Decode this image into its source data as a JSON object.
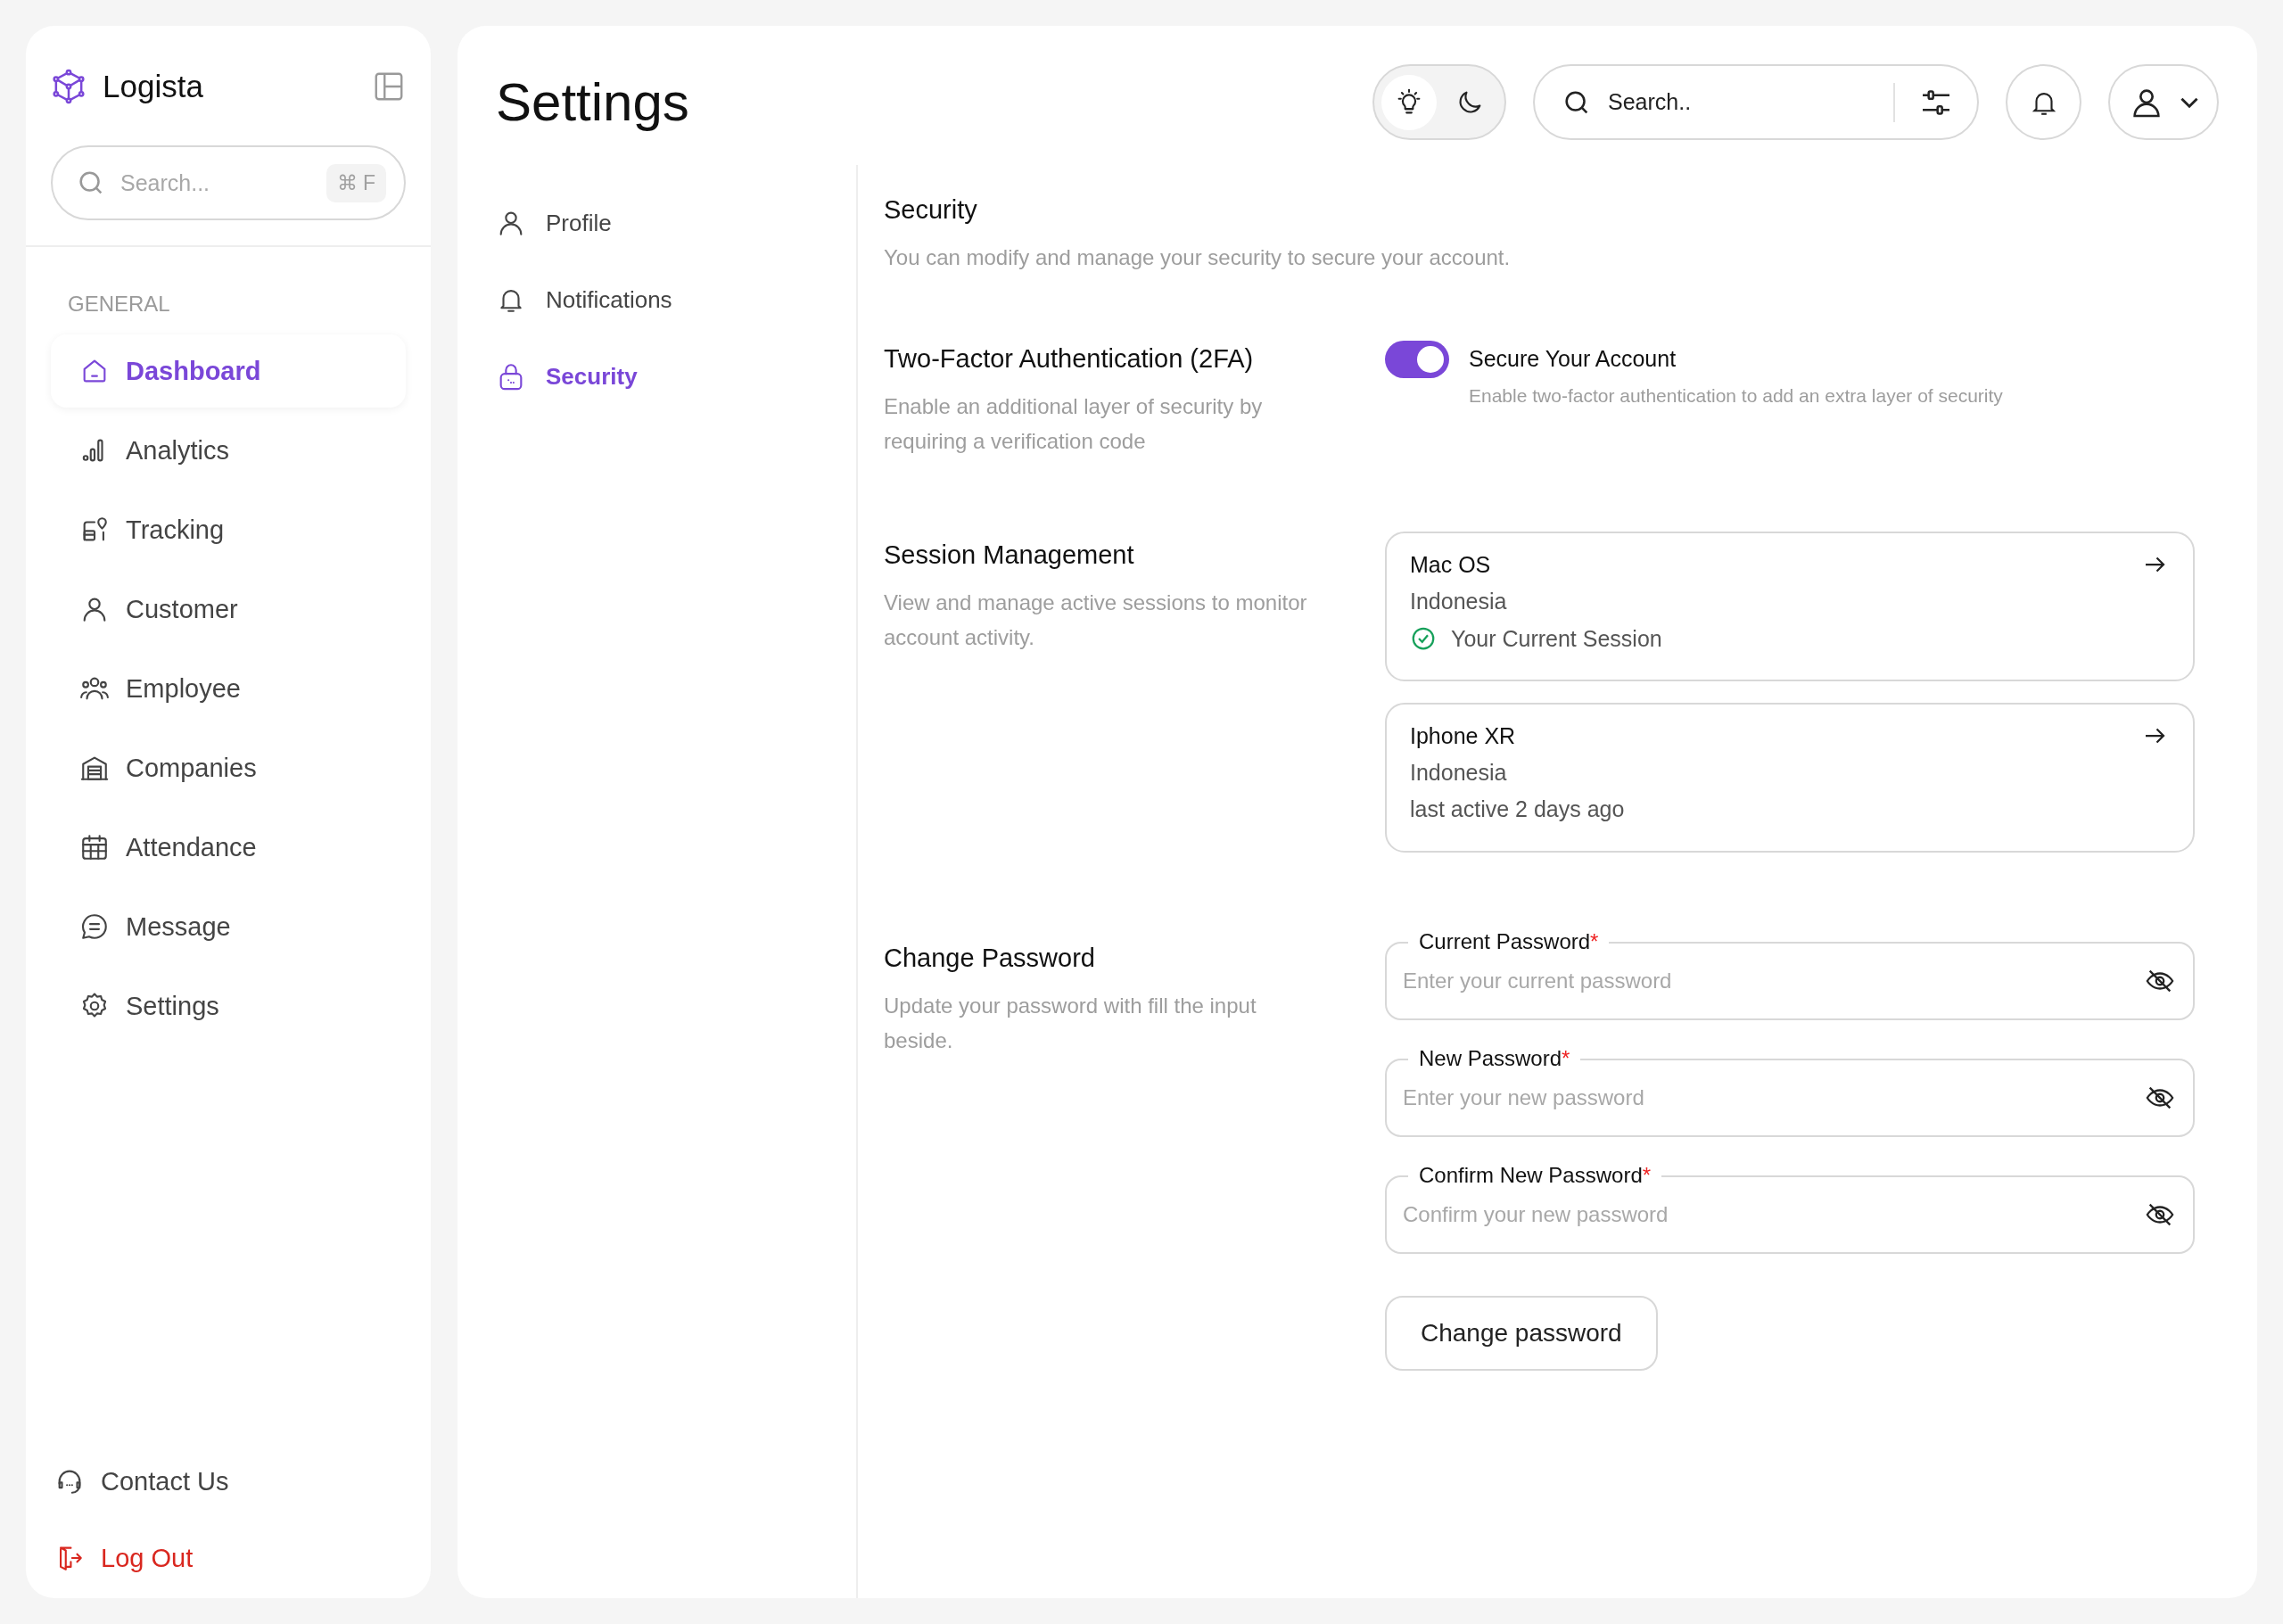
{
  "sidebar": {
    "brand": "Logista",
    "search": {
      "placeholder": "Search...",
      "shortcut": "⌘ F"
    },
    "section_label": "GENERAL",
    "items": [
      {
        "label": "Dashboard",
        "selected": true
      },
      {
        "label": "Analytics",
        "selected": false
      },
      {
        "label": "Tracking",
        "selected": false
      },
      {
        "label": "Customer",
        "selected": false
      },
      {
        "label": "Employee",
        "selected": false
      },
      {
        "label": "Companies",
        "selected": false
      },
      {
        "label": "Attendance",
        "selected": false
      },
      {
        "label": "Message",
        "selected": false
      },
      {
        "label": "Settings",
        "selected": false
      }
    ],
    "footer_items": [
      {
        "label": "Contact Us",
        "kind": "normal"
      },
      {
        "label": "Log Out",
        "kind": "danger"
      }
    ]
  },
  "header": {
    "title": "Settings",
    "theme_toggle": [
      {
        "kind": "light",
        "selected": true
      },
      {
        "kind": "dark",
        "selected": false
      }
    ],
    "search": {
      "placeholder": "Search.."
    }
  },
  "settings_nav": [
    {
      "label": "Profile",
      "selected": false
    },
    {
      "label": "Notifications",
      "selected": false
    },
    {
      "label": "Security",
      "selected": true
    }
  ],
  "security": {
    "title": "Security",
    "description": "You can modify and manage your security to secure your account."
  },
  "two_factor": {
    "title": "Two-Factor Authentication (2FA)",
    "description": "Enable an additional layer of security by requiring a verification code",
    "toggle": {
      "label": "Secure Your Account",
      "description": "Enable two-factor authentication to add an extra layer of security",
      "on": true
    }
  },
  "sessions": {
    "title": "Session Management",
    "description": "View and manage active sessions to monitor account activity.",
    "items": [
      {
        "device": "Mac OS",
        "location": "Indonesia",
        "status": "Your Current Session",
        "current": true
      },
      {
        "device": "Iphone XR",
        "location": "Indonesia",
        "status": "last active 2 days ago",
        "current": false
      }
    ]
  },
  "change_password": {
    "title": "Change Password",
    "description": "Update your password with fill the input beside.",
    "fields": [
      {
        "label": "Current Password",
        "required_mark": "*",
        "placeholder": "Enter your current password"
      },
      {
        "label": "New Password",
        "required_mark": "*",
        "placeholder": "Enter your new password"
      },
      {
        "label": "Confirm New Password",
        "required_mark": "*",
        "placeholder": "Confirm your new password"
      }
    ],
    "button": "Change password"
  }
}
